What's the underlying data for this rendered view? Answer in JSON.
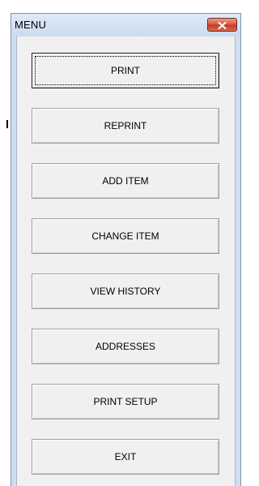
{
  "window": {
    "title": "MENU"
  },
  "icons": {
    "close": "close-icon"
  },
  "colors": {
    "close_button": "#c43a22",
    "titlebar": "#cadbee",
    "client": "#f0f0f0"
  },
  "menu": {
    "buttons": [
      {
        "label": "PRINT"
      },
      {
        "label": "REPRINT"
      },
      {
        "label": "ADD ITEM"
      },
      {
        "label": "CHANGE ITEM"
      },
      {
        "label": "VIEW HISTORY"
      },
      {
        "label": "ADDRESSES"
      },
      {
        "label": "PRINT SETUP"
      },
      {
        "label": "EXIT"
      }
    ]
  }
}
